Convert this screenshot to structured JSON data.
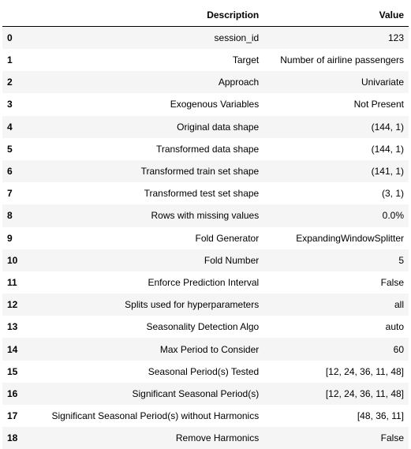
{
  "table": {
    "columns": [
      "",
      "Description",
      "Value"
    ],
    "rows": [
      {
        "index": "0",
        "description": "session_id",
        "value": "123"
      },
      {
        "index": "1",
        "description": "Target",
        "value": "Number of airline passengers"
      },
      {
        "index": "2",
        "description": "Approach",
        "value": "Univariate"
      },
      {
        "index": "3",
        "description": "Exogenous Variables",
        "value": "Not Present"
      },
      {
        "index": "4",
        "description": "Original data shape",
        "value": "(144, 1)"
      },
      {
        "index": "5",
        "description": "Transformed data shape",
        "value": "(144, 1)"
      },
      {
        "index": "6",
        "description": "Transformed train set shape",
        "value": "(141, 1)"
      },
      {
        "index": "7",
        "description": "Transformed test set shape",
        "value": "(3, 1)"
      },
      {
        "index": "8",
        "description": "Rows with missing values",
        "value": "0.0%"
      },
      {
        "index": "9",
        "description": "Fold Generator",
        "value": "ExpandingWindowSplitter"
      },
      {
        "index": "10",
        "description": "Fold Number",
        "value": "5"
      },
      {
        "index": "11",
        "description": "Enforce Prediction Interval",
        "value": "False"
      },
      {
        "index": "12",
        "description": "Splits used for hyperparameters",
        "value": "all"
      },
      {
        "index": "13",
        "description": "Seasonality Detection Algo",
        "value": "auto"
      },
      {
        "index": "14",
        "description": "Max Period to Consider",
        "value": "60"
      },
      {
        "index": "15",
        "description": "Seasonal Period(s) Tested",
        "value": "[12, 24, 36, 11, 48]"
      },
      {
        "index": "16",
        "description": "Significant Seasonal Period(s)",
        "value": "[12, 24, 36, 11, 48]"
      },
      {
        "index": "17",
        "description": "Significant Seasonal Period(s) without Harmonics",
        "value": "[48, 36, 11]"
      },
      {
        "index": "18",
        "description": "Remove Harmonics",
        "value": "False"
      }
    ]
  },
  "colors": {
    "stripe": "#f5f5f5",
    "border": "#000000"
  }
}
